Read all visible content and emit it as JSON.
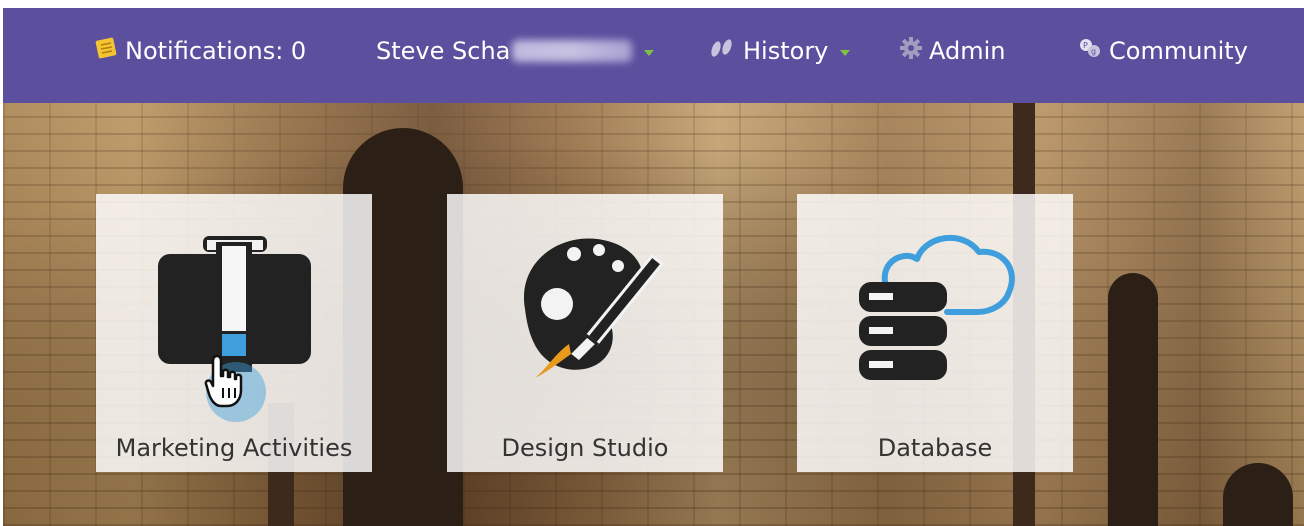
{
  "nav": {
    "notifications_label": "Notifications: 0",
    "user_name": "Steve Scha",
    "history_label": "History",
    "admin_label": "Admin",
    "community_label": "Community"
  },
  "tiles": [
    {
      "label": "Marketing Activities",
      "icon": "briefcase-icon"
    },
    {
      "label": "Design Studio",
      "icon": "paint-palette-icon"
    },
    {
      "label": "Database",
      "icon": "database-cloud-icon"
    }
  ],
  "colors": {
    "nav_bar": "#5b4f9e",
    "caret_green": "#7fc241",
    "icon_dark": "#222222",
    "accent_blue": "#3f9fdc",
    "brush_orange": "#e89a1c"
  }
}
